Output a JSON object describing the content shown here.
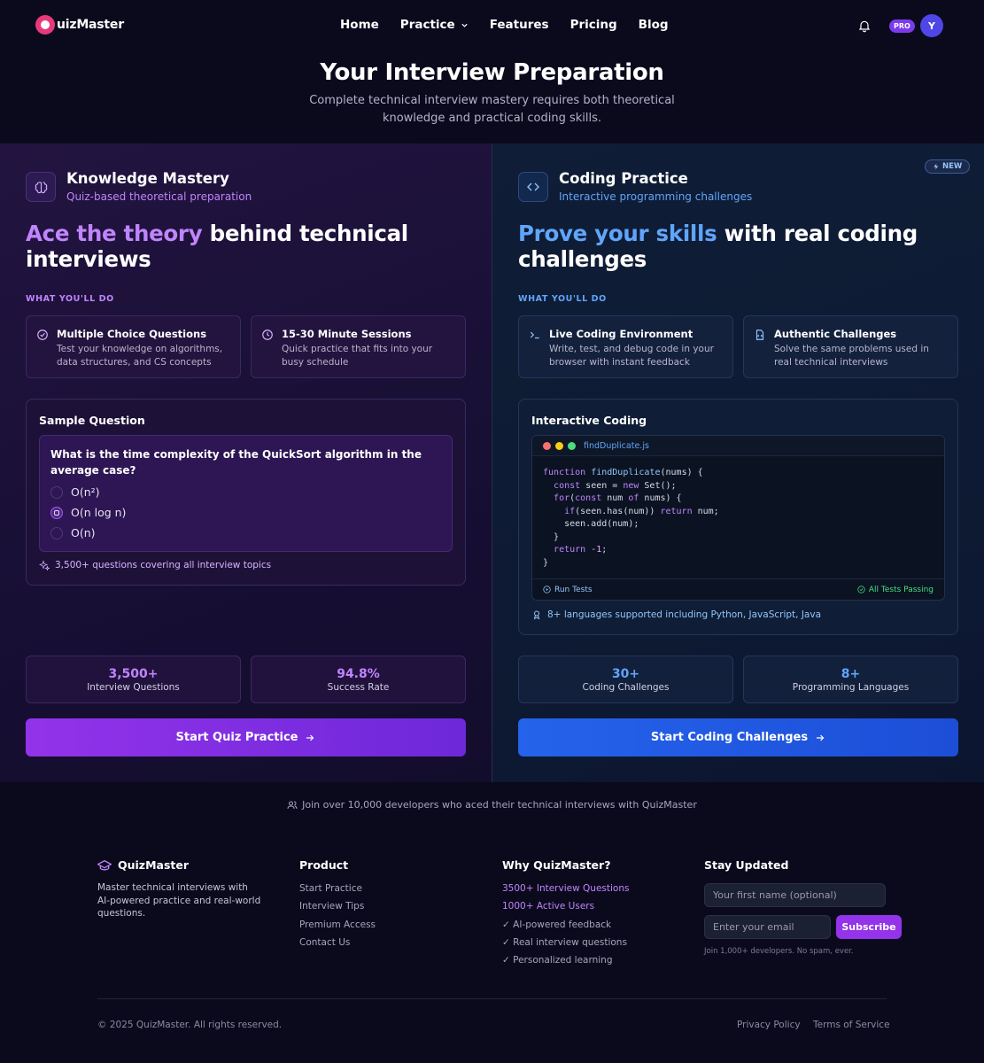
{
  "header": {
    "logo_letter": "Q",
    "logo_text": "uizMaster",
    "nav": [
      "Home",
      "Practice",
      "Features",
      "Pricing",
      "Blog"
    ],
    "pro_badge": "PRO",
    "avatar": "Y"
  },
  "hero": {
    "title": "Your Interview Preparation",
    "subtitle": "Complete technical interview mastery requires both theoretical knowledge and practical coding skills."
  },
  "left": {
    "title": "Knowledge Mastery",
    "subtitle": "Quiz-based theoretical preparation",
    "headline_accent": "Ace the theory",
    "headline_rest": " behind technical interviews",
    "section_label": "WHAT YOU'LL DO",
    "features": [
      {
        "title": "Multiple Choice Questions",
        "desc": "Test your knowledge on algorithms, data structures, and CS concepts"
      },
      {
        "title": "15-30 Minute Sessions",
        "desc": "Quick practice that fits into your busy schedule"
      }
    ],
    "sample_label": "Sample Question",
    "question": "What is the time complexity of the QuickSort algorithm in the average case?",
    "options": [
      "O(n²)",
      "O(n log n)",
      "O(n)"
    ],
    "selected": 1,
    "footnote": "3,500+ questions covering all interview topics",
    "stats": [
      {
        "value": "3,500+",
        "label": "Interview Questions"
      },
      {
        "value": "94.8%",
        "label": "Success Rate"
      }
    ],
    "cta": "Start Quiz Practice"
  },
  "right": {
    "title": "Coding Practice",
    "subtitle": "Interactive programming challenges",
    "badge": "NEW",
    "headline_accent": "Prove your skills",
    "headline_rest": " with real coding challenges",
    "section_label": "WHAT YOU'LL DO",
    "features": [
      {
        "title": "Live Coding Environment",
        "desc": "Write, test, and debug code in your browser with instant feedback"
      },
      {
        "title": "Authentic Challenges",
        "desc": "Solve the same problems used in real technical interviews"
      }
    ],
    "card_label": "Interactive Coding",
    "filename": "findDuplicate.js",
    "run_label": "Run Tests",
    "pass_label": "All Tests Passing",
    "footnote": "8+ languages supported including Python, JavaScript, Java",
    "stats": [
      {
        "value": "30+",
        "label": "Coding Challenges"
      },
      {
        "value": "8+",
        "label": "Programming Languages"
      }
    ],
    "cta": "Start Coding Challenges"
  },
  "join_text": "Join over 10,000 developers who aced their technical interviews with QuizMaster",
  "footer": {
    "brand": "QuizMaster",
    "brand_desc": "Master technical interviews with AI-powered practice and real-world questions.",
    "product_title": "Product",
    "product_links": [
      "Start Practice",
      "Interview Tips",
      "Premium Access",
      "Contact Us"
    ],
    "why_title": "Why QuizMaster?",
    "why_items": [
      "3500+ Interview Questions",
      "1000+ Active Users",
      "✓ AI-powered feedback",
      "✓ Real interview questions",
      "✓ Personalized learning"
    ],
    "stay_title": "Stay Updated",
    "name_placeholder": "Your first name (optional)",
    "email_placeholder": "Enter your email",
    "subscribe": "Subscribe",
    "disclaimer": "Join 1,000+ developers. No spam, ever.",
    "copyright": "© 2025 QuizMaster. All rights reserved.",
    "privacy": "Privacy Policy",
    "terms": "Terms of Service"
  },
  "colors": {
    "purple": "#c084fc",
    "blue": "#60a5fa",
    "green": "#4ade80"
  }
}
